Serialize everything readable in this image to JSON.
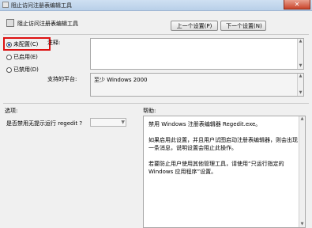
{
  "window": {
    "title": "阻止访问注册表编辑工具",
    "close_glyph": "✕"
  },
  "header": {
    "title": "阻止访问注册表编辑工具",
    "prev_label": "上一个设置(P)",
    "next_label": "下一个设置(N)"
  },
  "radios": [
    {
      "label": "未配置(C)",
      "checked": true
    },
    {
      "label": "已启用(E)",
      "checked": false
    },
    {
      "label": "已禁用(D)",
      "checked": false
    }
  ],
  "comment": {
    "label": "注释:",
    "value": ""
  },
  "platform": {
    "label": "支持的平台:",
    "value": "至少 Windows 2000"
  },
  "options": {
    "label": "选项:",
    "question": "是否禁用无提示运行 regedit ?",
    "select_value": ""
  },
  "help": {
    "label": "帮助:",
    "paragraphs": [
      "禁用 Windows 注册表编辑器 Regedit.exe。",
      "如果启用此设置，并且用户试图启动注册表编辑器，则会出现一条消息，说明设置会阻止此操作。",
      "若要防止用户使用其他管理工具，请使用“只运行指定的 Windows 应用程序”设置。"
    ]
  },
  "colors": {
    "highlight_box": "#dd1111",
    "radio_dot": "#1a4ea8",
    "title_bar": "#b8cfe8"
  }
}
